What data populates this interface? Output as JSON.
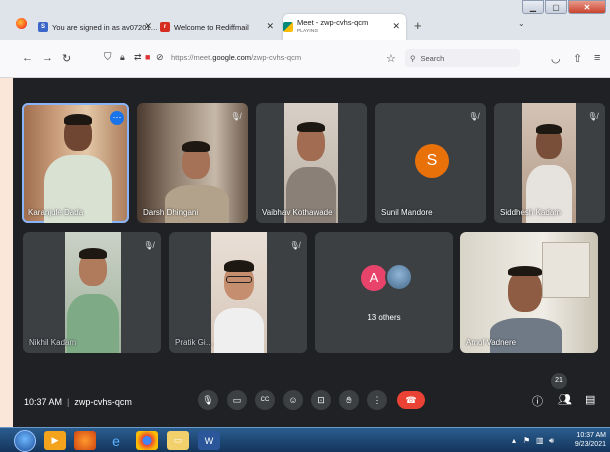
{
  "browser": {
    "tabs": [
      {
        "title": "You are signed in as av07201…",
        "favicon": "S",
        "favicon_color": "#3a67c8"
      },
      {
        "title": "Welcome to Rediffmail",
        "favicon": "r",
        "favicon_color": "#d62d20"
      },
      {
        "title": "Meet - zwp-cvhs-qcm",
        "subtitle": "PLAYING",
        "favicon": "M",
        "favicon_color": "#00897b",
        "active": true
      }
    ],
    "url_prefix": "https://meet.",
    "url_domain": "google.com",
    "url_path": "/zwp-cvhs-qcm",
    "search_placeholder": "Search"
  },
  "meet": {
    "participants": [
      {
        "name": "Karanjule Dada",
        "muted": false,
        "speaking": true
      },
      {
        "name": "Darsh Dhingani",
        "muted": true
      },
      {
        "name": "Vaibhav Kothawade",
        "muted": false
      },
      {
        "name": "Sunil Mandore",
        "muted": true,
        "avatar_letter": "S",
        "avatar_color": "#e8710a"
      },
      {
        "name": "Siddhesh Kadam",
        "muted": true
      },
      {
        "name": "Nikhil Kadam",
        "muted": true
      },
      {
        "name": "Pratik Gi…",
        "muted": true
      },
      {
        "name": "",
        "others": "13 others",
        "avatar_letter": "A",
        "avatar_color": "#e8446b"
      },
      {
        "name": "Amol Vadnere",
        "muted": false
      }
    ],
    "time": "10:37 AM",
    "meeting_code": "zwp-cvhs-qcm",
    "participant_count": "21"
  },
  "taskbar": {
    "clock_time": "10:37 AM",
    "clock_date": "9/23/2021"
  },
  "colors": {
    "meet_bg": "#202124",
    "tile_bg": "#3c4043",
    "end_call": "#ea4335",
    "accent": "#8ab4f8"
  }
}
